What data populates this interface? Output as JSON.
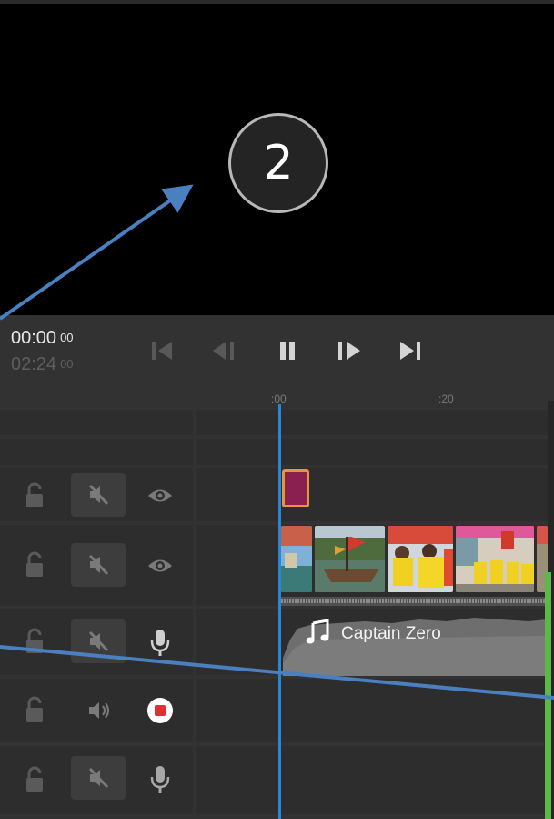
{
  "preview": {
    "step_number": "2"
  },
  "timecode": {
    "current": "00:00",
    "current_frames": "00",
    "duration": "02:24",
    "duration_frames": "00"
  },
  "transport": {
    "buttons": [
      "go-to-start",
      "step-back",
      "pause",
      "step-forward",
      "go-to-end"
    ]
  },
  "ruler": {
    "ticks": [
      ":00",
      ":20"
    ]
  },
  "tracks": [
    {
      "name": "video-track-2",
      "lock": "unlocked",
      "mute": "muted",
      "extra": "visibility"
    },
    {
      "name": "video-track-1",
      "lock": "unlocked",
      "mute": "muted",
      "extra": "visibility"
    },
    {
      "name": "audio-track-1",
      "lock": "unlocked",
      "mute": "muted",
      "extra": "microphone"
    },
    {
      "name": "audio-track-2",
      "lock": "unlocked",
      "mute": "unmuted",
      "extra": "record"
    },
    {
      "name": "audio-track-3",
      "lock": "unlocked",
      "mute": "muted",
      "extra": "microphone"
    }
  ],
  "audio_clip": {
    "title": "Captain Zero",
    "icon": "music-note-icon"
  },
  "colors": {
    "playhead": "#2a86d6",
    "annotation_arrow": "#4a7fc0",
    "clip_marker_fill": "#8a2050",
    "clip_marker_border": "#e8963a",
    "level_meter": "#5cb84a",
    "record": "#e03030"
  }
}
